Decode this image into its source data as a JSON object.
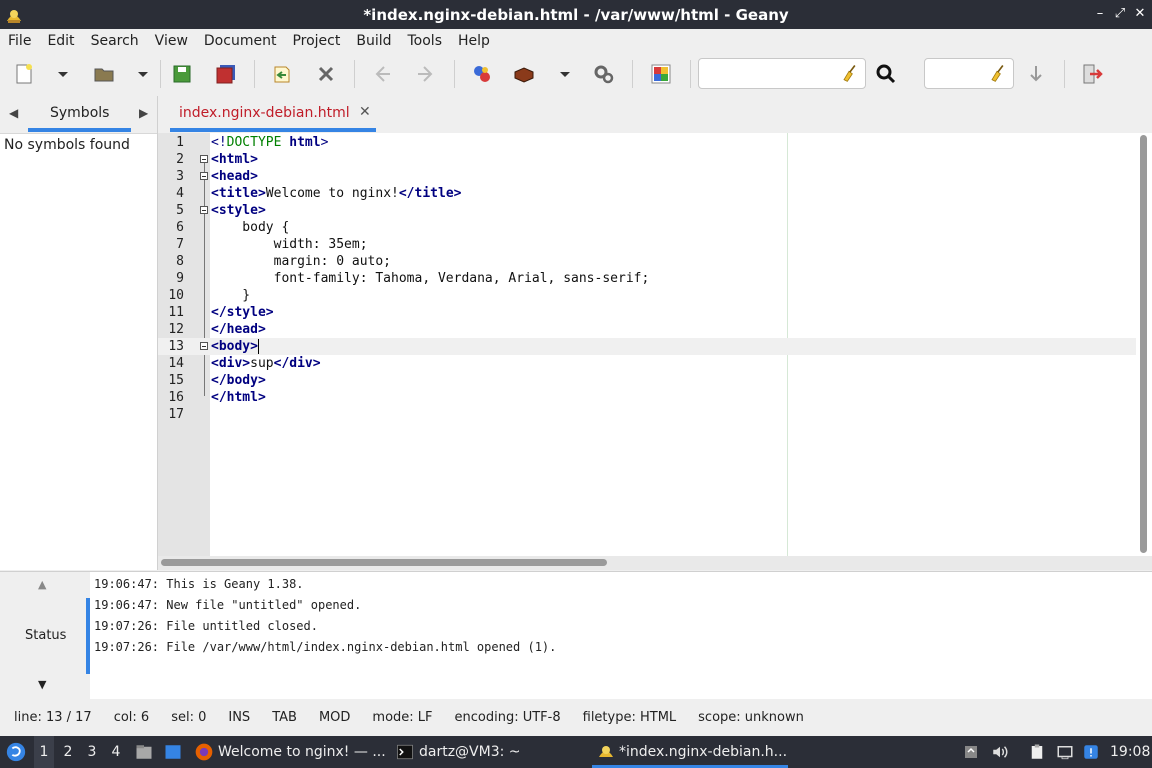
{
  "window": {
    "title": "*index.nginx-debian.html - /var/www/html - Geany"
  },
  "menubar": [
    "File",
    "Edit",
    "Search",
    "View",
    "Document",
    "Project",
    "Build",
    "Tools",
    "Help"
  ],
  "sidebar": {
    "tab_label": "Symbols",
    "message": "No symbols found"
  },
  "editor": {
    "tab_name": "index.nginx-debian.html",
    "tab_close": "✕",
    "current_line": 13,
    "lines": [
      "<!DOCTYPE html>",
      "<html>",
      "<head>",
      "<title>Welcome to nginx!</title>",
      "<style>",
      "    body {",
      "        width: 35em;",
      "        margin: 0 auto;",
      "        font-family: Tahoma, Verdana, Arial, sans-serif;",
      "    }",
      "</style>",
      "</head>",
      "<body>",
      "<div>sup</div>",
      "</body>",
      "</html>",
      ""
    ]
  },
  "messages": {
    "label": "Status",
    "lines": [
      "19:06:47: This is Geany 1.38.",
      "19:06:47: New file \"untitled\" opened.",
      "19:07:26: File untitled closed.",
      "19:07:26: File /var/www/html/index.nginx-debian.html opened (1)."
    ]
  },
  "statusbar": {
    "line": "line: 13 / 17",
    "col": "col: 6",
    "sel": "sel: 0",
    "ins": "INS",
    "tab": "TAB",
    "mod": "MOD",
    "mode": "mode: LF",
    "encoding": "encoding: UTF-8",
    "filetype": "filetype: HTML",
    "scope": "scope: unknown"
  },
  "taskbar": {
    "workspaces": [
      "1",
      "2",
      "3",
      "4"
    ],
    "tasks": [
      "Welcome to nginx! — ...",
      "dartz@VM3: ~",
      "*index.nginx-debian.h..."
    ],
    "clock": "19:08"
  },
  "colors": {
    "accent": "#3584e4",
    "tab_text": "#c01c28",
    "tag": "#000080",
    "doctype": "#008000"
  }
}
